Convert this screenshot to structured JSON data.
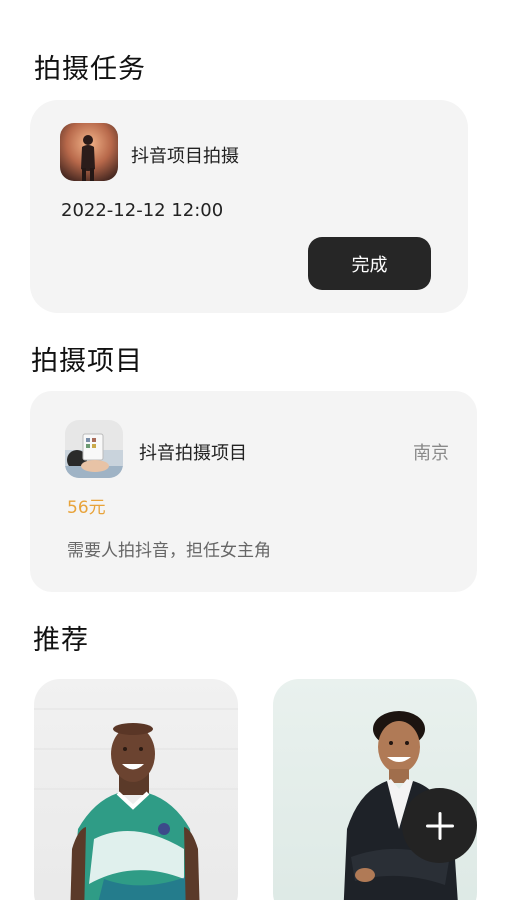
{
  "task_section": {
    "title": "拍摄任务",
    "card": {
      "name": "抖音项目拍摄",
      "time": "2022-12-12 12:00",
      "button_label": "完成"
    }
  },
  "project_section": {
    "title": "拍摄项目",
    "card": {
      "name": "抖音拍摄项目",
      "city": "南京",
      "price": "56元",
      "description": "需要人拍抖音，担任女主角"
    }
  },
  "recommend_section": {
    "title": "推荐",
    "items": [
      {
        "photo": "smiling-man-portrait"
      },
      {
        "photo": "man-in-suit-portrait"
      }
    ]
  },
  "fab": {
    "icon": "plus-icon"
  },
  "colors": {
    "card_bg": "#f4f4f4",
    "button_bg": "#262626",
    "price": "#e8a33a",
    "fab_bg": "#232323"
  }
}
